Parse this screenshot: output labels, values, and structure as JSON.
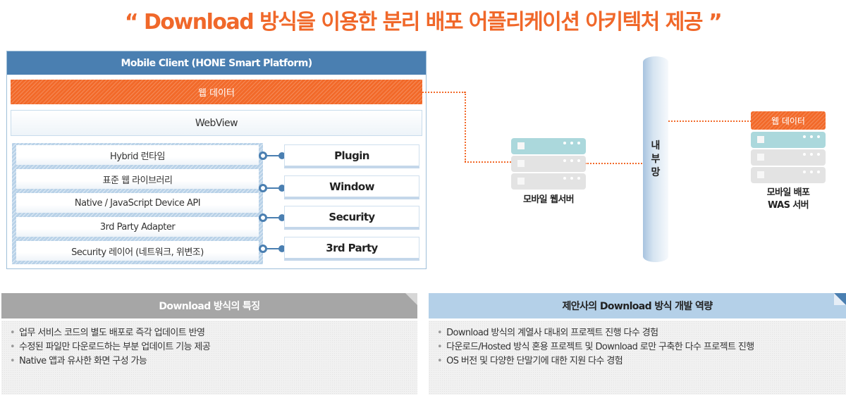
{
  "title": "“ Download 방식을 이용한 분리 배포 어플리케이션 아키텍처 제공 ”",
  "colors": {
    "accent_orange": "#f26a2a",
    "client_header_blue": "#4a7fb1",
    "panel_gray": "#a6a6a6",
    "panel_blue": "#b4d0e8"
  },
  "client": {
    "header": "Mobile Client (HONE Smart Platform)",
    "web_data": "웹 데이터",
    "webview": "WebView",
    "layers": [
      "Hybrid 런타임",
      "표준 웹 라이브러리",
      "Native / JavaScript Device API",
      "3rd Party Adapter",
      "Security 레이어 (네트워크, 위변조)"
    ],
    "modules": [
      "Plugin",
      "Window",
      "Security",
      "3rd Party"
    ]
  },
  "servers": {
    "web_server_label": "모바일 웹서버",
    "internal_network_label": [
      "내",
      "부",
      "망"
    ],
    "was_web_data": "웹 데이터",
    "was_label_line1": "모바일 배포",
    "was_label_line2": "WAS 서버"
  },
  "panels": {
    "left": {
      "title": "Download 방식의 특징",
      "items": [
        "업무 서비스 코드의 별도 배포로 즉각 업데이트 반영",
        "수정된 파일만 다운로드하는 부분 업데이트 기능 제공",
        "Native 앱과 유사한 화면 구성 가능"
      ]
    },
    "right": {
      "title": "제안사의 Download 방식 개발 역량",
      "items": [
        "Download 방식의 계열사 대내외 프로젝트 진행 다수 경험",
        "다운로드/Hosted 방식 혼용 프로젝트 및 Download 로만 구축한 다수 프로젝트 진행",
        "OS 버전 및 다양한 단말기에 대한 지원 다수 경험"
      ]
    }
  }
}
